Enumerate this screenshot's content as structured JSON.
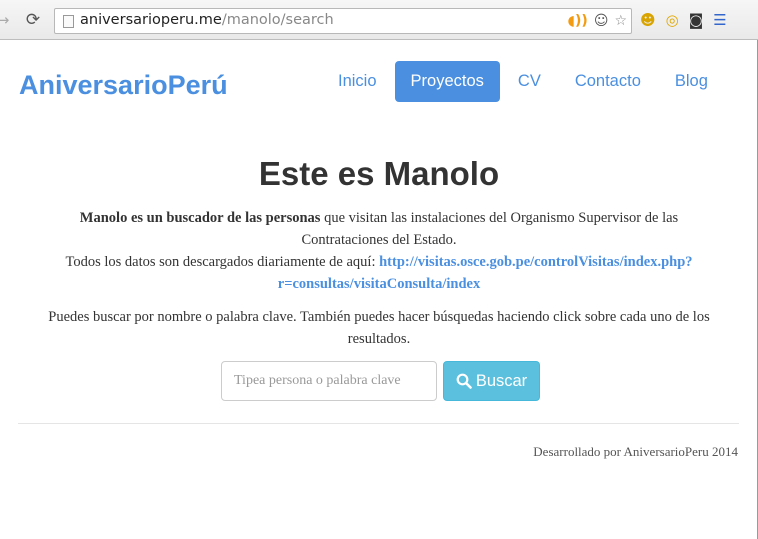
{
  "browser": {
    "url_domain": "aniversarioperu.me",
    "url_path": "/manolo/search",
    "icons": [
      "back-icon",
      "reload-icon",
      "page-icon",
      "rss-icon",
      "reddit-icon",
      "bookmark-star-icon",
      "extension-icon",
      "halo-extension-icon",
      "avatar-extension-icon",
      "menu-icon"
    ]
  },
  "site": {
    "brand": "AniversarioPerú",
    "nav": [
      {
        "label": "Inicio",
        "active": false
      },
      {
        "label": "Proyectos",
        "active": true
      },
      {
        "label": "CV",
        "active": false
      },
      {
        "label": "Contacto",
        "active": false
      },
      {
        "label": "Blog",
        "active": false
      }
    ],
    "accent_color": "#4a8fe0"
  },
  "main": {
    "title": "Este es Manolo",
    "intro_bold": "Manolo es un buscador de las personas",
    "intro_rest": " que visitan las instalaciones del Organismo Supervisor de las Contrataciones del Estado.",
    "data_prefix": "Todos los datos son descargados diariamente de aquí: ",
    "data_link": "http://visitas.osce.gob.pe/controlVisitas/index.php?r=consultas/visitaConsulta/index",
    "hint": "Puedes buscar por nombre o palabra clave. También puedes hacer búsquedas haciendo click sobre cada uno de los resultados.",
    "search_placeholder": "Tipea persona o palabra clave",
    "search_value": "",
    "search_button": "Buscar",
    "button_color": "#5bc0de"
  },
  "footer": {
    "text": "Desarrollado por AniversarioPeru 2014"
  }
}
